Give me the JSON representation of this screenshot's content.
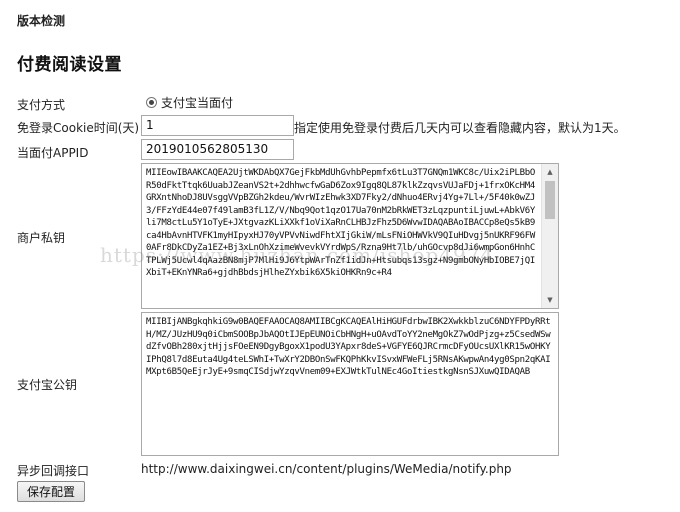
{
  "header": {
    "version_check": "版本检测",
    "title": "付费阅读设置"
  },
  "form": {
    "pay_method": {
      "label": "支付方式",
      "option_label": "支付宝当面付",
      "selected": true
    },
    "free_days": {
      "label": "免登录Cookie时间(天)",
      "value": "1",
      "hint": "指定使用免登录付费后几天内可以查看隐藏内容，默认为1天。"
    },
    "appid": {
      "label": "当面付APPID",
      "value": "2019010562805130"
    },
    "merchant_key": {
      "label": "商户私钥",
      "value": "MIIEowIBAAKCAQEA2UjtWKDAbQX7GejFkbMdUhGvhbPepmfx6tLu3T7GNQm1WKC8c/Uix2iPLBbOR50dFktTtqk6UuabJZeanVS2t+2dhhwcfwGaD6Zox9Igq8QL87klkZzqvsVUJaFDj+1frxOKcHM4GRXntNhoDJ8UVsggVVpBZGh2kdeu/WvrWIzEhwk3XD7Fky2/dNhuo4ERvj4Yg+7Ll+/5F40k0wZJ3/FFzYdE44e07f49lamB3fL1Z/V/Nbq9Qot1qzO17Ua70nM2bRkWET3zLqzpuntiLjuwL+AbkV6Yli7M8ctLu5Y1oTyE+JXtgvazKLiXXkf1oViXaRnCLHBJzFhz5D6WvwIDAQABAoIBACCp8eQs5kB9ca4HbAvnHTVFK1myHIpyxHJ70yVPVvNiwdFhtXIjGkiW/mLsFNiOHWVkV9QIuHDvgj5nUKRF96FW0AFr8DkCDyZa1EZ+Bj3xLnOhXzimeWvevkVYrdWpS/Rzna9Ht7lb/uhGOcvp8dJi6wmpGon6HnhCTPLWj5Ucwl4qAazBN8mjP7MlHi9J6YtpWArTnZf1idJn+Htsubqs13sgz+N9gmbONyHbIOBE7jQIXbiT+EKnYNRa6+gjdhBbdsjHlheZYxbik6X5kiOHKRn9c+R4"
    },
    "alipay_pubkey": {
      "label": "支付宝公钥",
      "value": "MIIBIjANBgkqhkiG9w0BAQEFAAOCAQ8AMIIBCgKCAQEAlHiHGUFdrbwIBK2XwkkblzuC6NDYFPDyRRtH/MZ/JUzHU9q0iCbmSOOBpJbAQOtIJEpEUNOiCbHNgH+uOAvdToYY2neMgOkZ7wOdPjzg+z5CsedWSwdZfvOBh280xjtHjjsFOeEN9DgyBgoxX1podU3YApxr8deS+VGFYE6QJRCrmcDFyOUcsUXlKR15wOHKYIPhQ8l7d8Euta4Ug4teLSWhI+TwXrY2DBOnSwFKQPhKkvISvxWFWeFLj5RNsAKwpwAn4yg0Spn2qKAIMXpt6B5QeEjrJyE+9smqCISdjwYzqvVnem09+EXJWtkTulNEc4GoItiestkgNsnSJXuwQIDAQAB"
    },
    "notify": {
      "label": "异步回调接口",
      "value": "http://www.daixingwei.cn/content/plugins/WeMedia/notify.php"
    }
  },
  "actions": {
    "save_label": "保存配置"
  },
  "watermark": "https://www.huzhan.com/ishop4974"
}
